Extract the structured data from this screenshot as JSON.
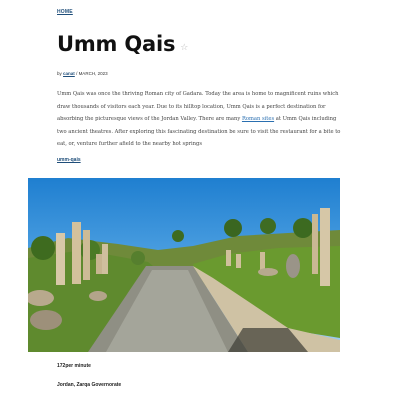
{
  "breadcrumb": {
    "label": "HOME"
  },
  "post": {
    "title": "Umm Qais",
    "meta_prefix": "by",
    "author": "canat",
    "date": "/ MARCH, 2023",
    "body_before_link": "Umm Qais was once the thriving Roman city of Gadara. Today the area is home to magnificent ruins which draw thousands of visitors each year. Due to its hilltop location, Umm Qais is a perfect destination for absorbing the picturesque views of the Jordan Valley. There are many ",
    "body_link": "Roman sites",
    "body_after_link": " at Umm Qais including two ancient theatres. After exploring this fascinating destination be sure to visit the restaurant for a bite to eat, or, venture further afield to the nearby hot springs",
    "tag": "umm-qais"
  },
  "photo": {
    "caption_duration": "172per minute",
    "caption_location": "Jordan, Zarqa Governorate"
  },
  "colors": {
    "link": "#1f4e7a",
    "text": "#444444",
    "title": "#111111"
  },
  "icons": {
    "favorite": "star-outline-icon"
  }
}
